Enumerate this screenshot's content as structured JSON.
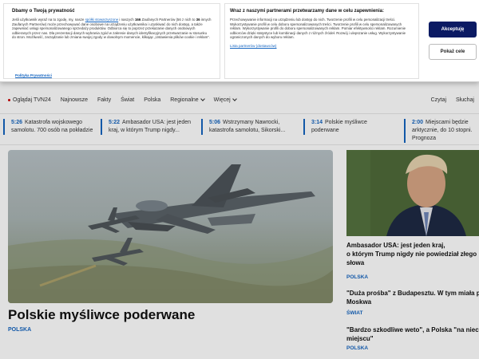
{
  "consent": {
    "left_title": "Dbamy o Twoją prywatność",
    "left_text_1": "Jeśli użytkownik wyraź na to zgodę, my, nasze",
    "left_link": "spółki stowarzyszone",
    "left_text_2": "i naszych",
    "left_count_1": "166",
    "left_text_3": "Zaufanych Partnerów (56 z nich to",
    "left_count_2": "36",
    "left_text_4": "innych Zaufanych Partnerów) może przechowywać dane osobowe na urządzeniu użytkownika i uzyskiwać do nich dostęp, a także zapewniać usługi spersonalizowanego sprzedaży produktów. Odbiorca się to poprzez przekazanie danych osobowych odbieranych przez nas. Dla prezentacji danych wybrania zgód w zakresie danych identyfikacyjnych przetwarzanie w stosunku do stron. Możliwość, zarządzanie lub zmiana swojej zgody w dowolnym momencie, klikając „Ustawienia plików cookie i reklam”.",
    "policy_link": "Polityka Prywatności",
    "mid_title": "Wraz z naszymi partnerami przetwarzamy dane w celu zapewnienia:",
    "mid_text": "Przechowywanie informacji na urządzeniu lub dostęp do nich. Tworzenie profili w celu personalizacji treści. Wykorzystywanie profili w celu doboru spersonalizowanych treści. Tworzenie profili w celu spersonalizowanych reklam. Wykorzystywanie profili do doboru spersonalizowanych reklam. Pomiar efektywności reklam. Rozumienie odbiorców dzięki statystyce lub kombinacji danych z różnych źródeł. Rozwój i ulepszanie usług. Wykorzystywanie ograniczonych danych do wyboru reklam.",
    "partners_link": "Lista partnerów (dostawców)",
    "accept_label": "Akceptuję",
    "more_label": "Pokaż cele"
  },
  "nav": {
    "items": [
      "Oglądaj TVN24",
      "Najnowsze",
      "Fakty",
      "Świat",
      "Polska",
      "Regionalne",
      "Więcej"
    ],
    "right": [
      "Czytaj",
      "Słuchaj"
    ]
  },
  "ticker": [
    {
      "time": "5:26",
      "text": "Katastrofa wojskowego samolotu. 700 osób na pokładzie"
    },
    {
      "time": "5:22",
      "text": "Ambasador USA: jest jeden kraj, w którym Trump nigdy..."
    },
    {
      "time": "5:06",
      "text": "Wstrzymany Nawrocki, katastrofa samolotu, Sikorski..."
    },
    {
      "time": "3:14",
      "text": "Polskie myśliwce poderwane"
    },
    {
      "time": "2:00",
      "text": "Miejscami będzie arktycznie, do 10 stopni. Prognoza"
    }
  ],
  "hero": {
    "title": "Polskie myśliwce poderwane",
    "category": "POLSKA"
  },
  "side": [
    {
      "title_1": "Ambasador USA: jest jeden kraj,",
      "title_2": "o którym Trump nigdy nie powiedział złego",
      "title_3": "słowa",
      "category": "POLSKA"
    },
    {
      "title_1": "\"Duża prośba\" z Budapesztu. W tym miała pom",
      "title_2": "Moskwa",
      "category": "ŚWIAT"
    },
    {
      "title_1": "\"Bardzo szkodliwe weto\", a Polska \"na niech",
      "title_2": "miejscu\"",
      "category": "POLSKA"
    }
  ]
}
